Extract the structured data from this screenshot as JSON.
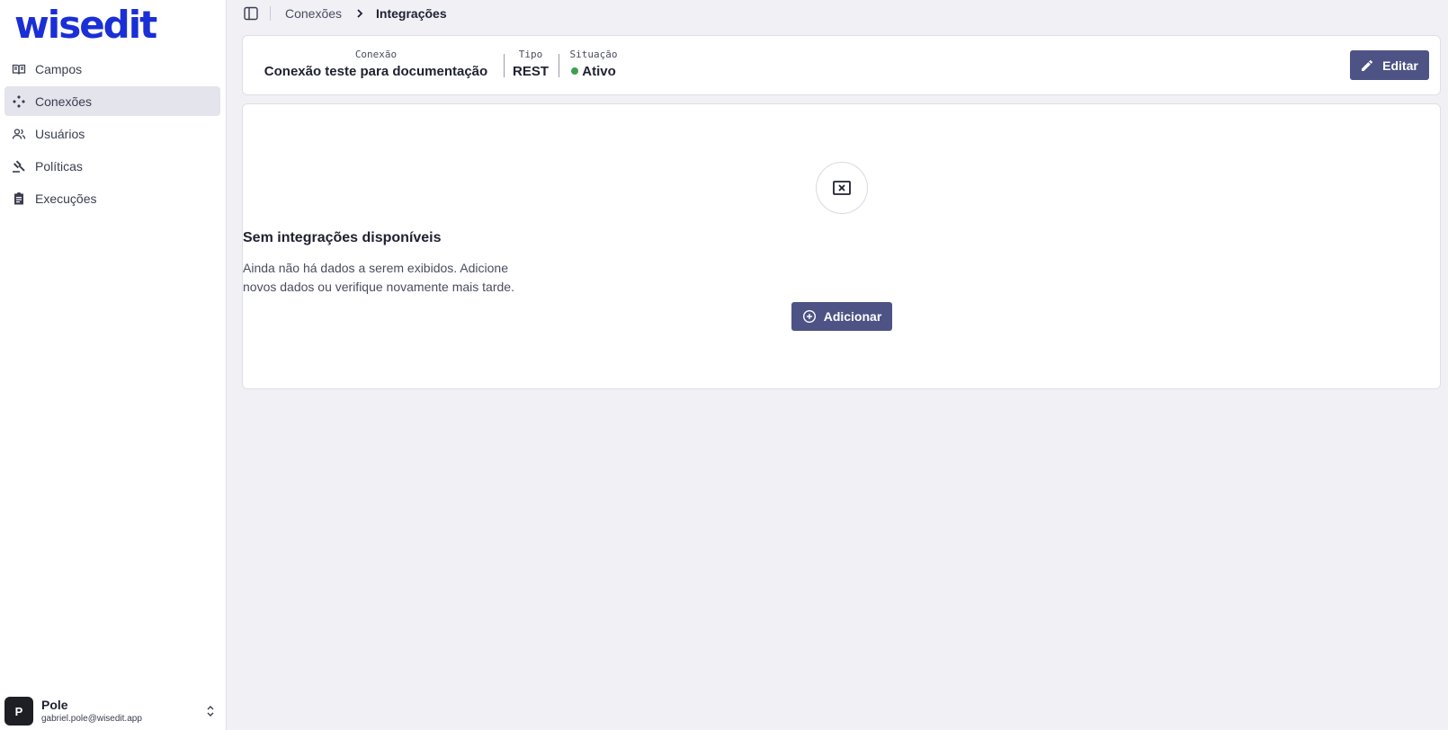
{
  "app": {
    "logo_text": "wisedit",
    "brand_color": "#1a2fd6"
  },
  "sidebar": {
    "items": [
      {
        "label": "Campos",
        "icon": "book-open-icon",
        "active": false
      },
      {
        "label": "Conexões",
        "icon": "connections-icon",
        "active": true
      },
      {
        "label": "Usuários",
        "icon": "users-icon",
        "active": false
      },
      {
        "label": "Políticas",
        "icon": "gavel-icon",
        "active": false
      },
      {
        "label": "Execuções",
        "icon": "clipboard-icon",
        "active": false
      }
    ]
  },
  "user": {
    "initial": "P",
    "name": "Pole",
    "email": "gabriel.pole@wisedit.app"
  },
  "breadcrumb": {
    "parent": "Conexões",
    "current": "Integrações"
  },
  "connection": {
    "conexao_label": "Conexão",
    "conexao_value": "Conexão teste para documentação",
    "tipo_label": "Tipo",
    "tipo_value": "REST",
    "situacao_label": "Situação",
    "situacao_value": "Ativo",
    "status_color": "#3fa050"
  },
  "actions": {
    "edit_label": "Editar",
    "add_label": "Adicionar"
  },
  "empty_state": {
    "title": "Sem integrações disponíveis",
    "line1": "Ainda não há dados a serem exibidos. Adicione",
    "line2": "novos dados ou verifique novamente mais tarde."
  },
  "colors": {
    "primary_button": "#4d5385",
    "background": "#f0f0f5",
    "active_nav": "#e3e4ec"
  }
}
